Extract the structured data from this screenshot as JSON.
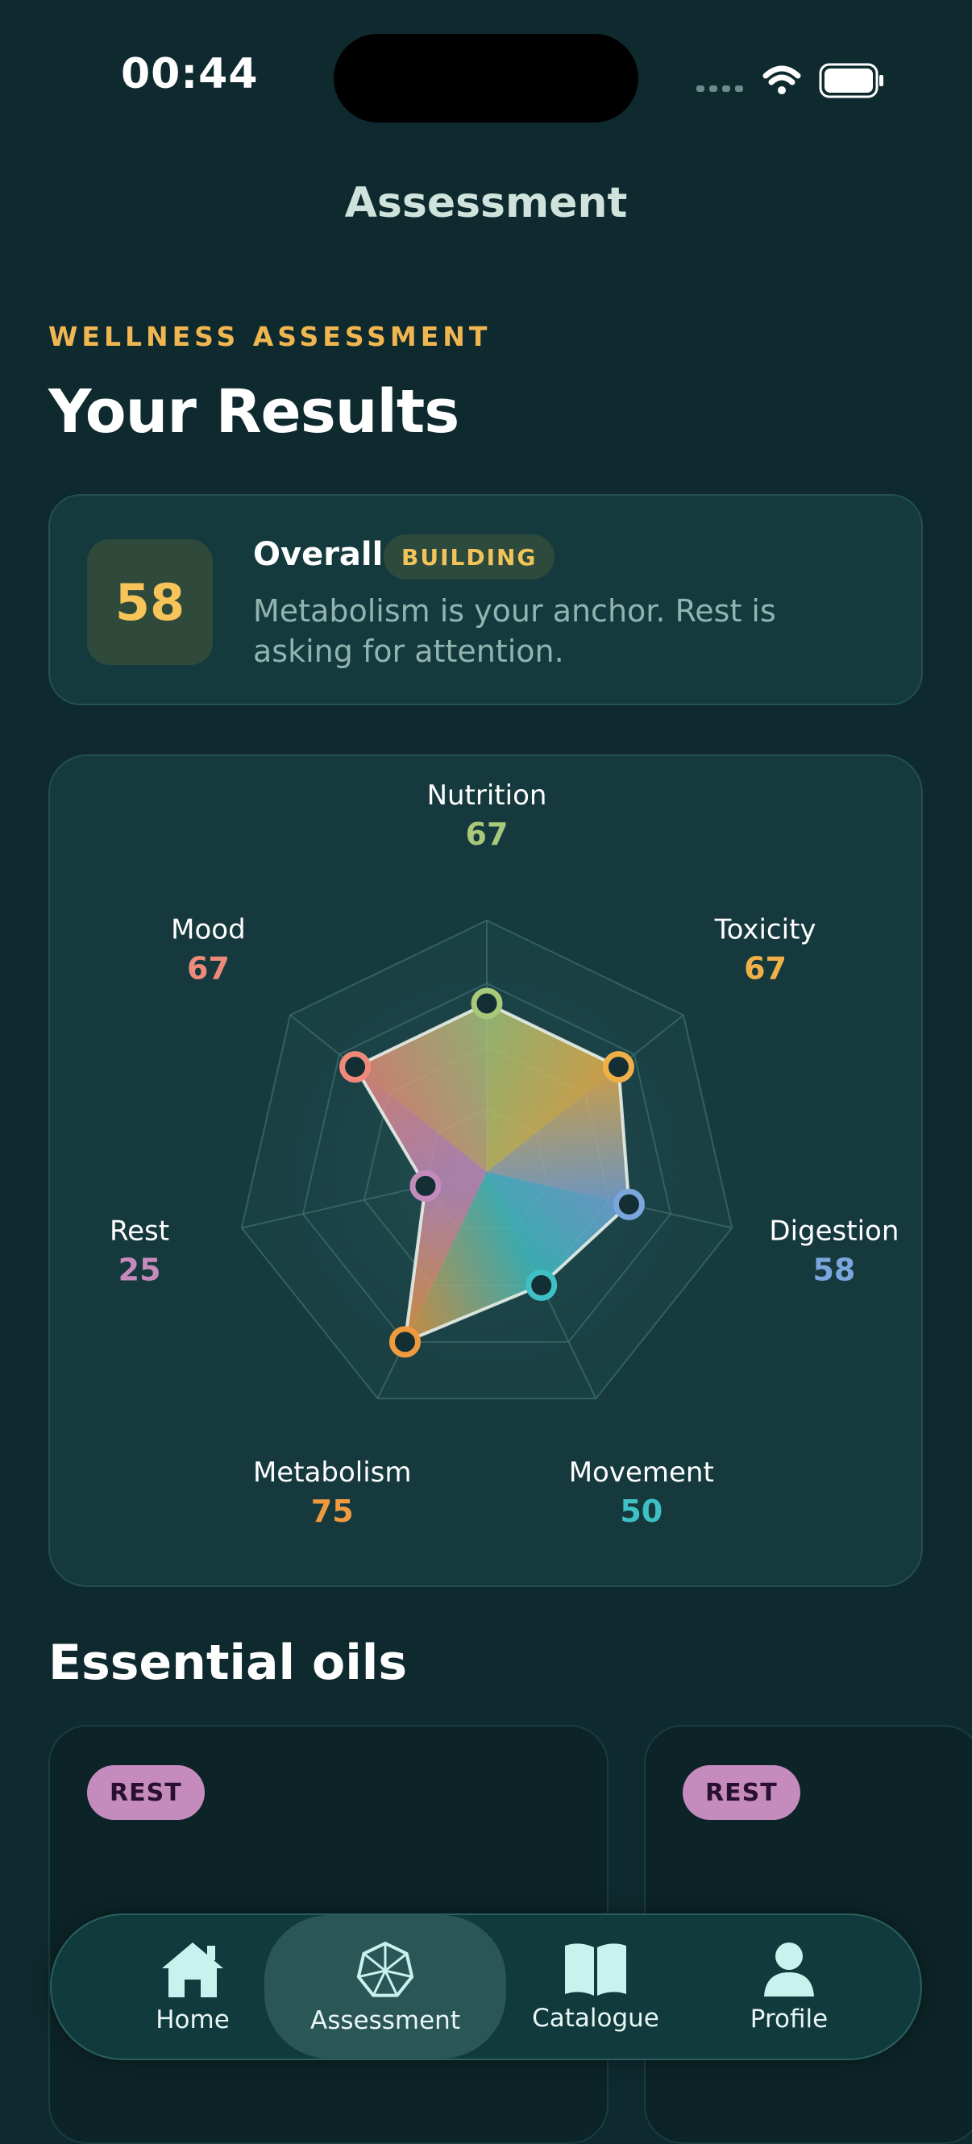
{
  "status_bar": {
    "time": "00:44"
  },
  "nav": {
    "title": "Assessment"
  },
  "header": {
    "eyebrow": "WELLNESS ASSESSMENT",
    "title": "Your Results"
  },
  "overall": {
    "score": "58",
    "label": "Overall",
    "badge": "BUILDING",
    "description": "Metabolism is your anchor. Rest is asking for attention."
  },
  "chart_data": {
    "type": "radar",
    "scale_max": 100,
    "rings": 4,
    "axes": [
      {
        "name": "Nutrition",
        "value": 67,
        "color": "#a8c87a"
      },
      {
        "name": "Toxicity",
        "value": 67,
        "color": "#f0b048"
      },
      {
        "name": "Digestion",
        "value": 58,
        "color": "#7aa6dd"
      },
      {
        "name": "Movement",
        "value": 50,
        "color": "#3ec0c4"
      },
      {
        "name": "Metabolism",
        "value": 75,
        "color": "#f09a3e"
      },
      {
        "name": "Rest",
        "value": 25,
        "color": "#c58bbd"
      },
      {
        "name": "Mood",
        "value": 67,
        "color": "#ef8a7a"
      }
    ]
  },
  "oils": {
    "title": "Essential oils",
    "cards": [
      {
        "tag": "REST"
      },
      {
        "tag": "REST"
      }
    ]
  },
  "tabbar": {
    "items": [
      {
        "label": "Home",
        "icon": "home-icon"
      },
      {
        "label": "Assessment",
        "icon": "heptagon-web-icon",
        "active": true
      },
      {
        "label": "Catalogue",
        "icon": "book-icon"
      },
      {
        "label": "Profile",
        "icon": "person-icon"
      }
    ]
  },
  "colors": {
    "background": "#0e2a2e",
    "accent": "#f0b650",
    "card": "#143a3e"
  }
}
